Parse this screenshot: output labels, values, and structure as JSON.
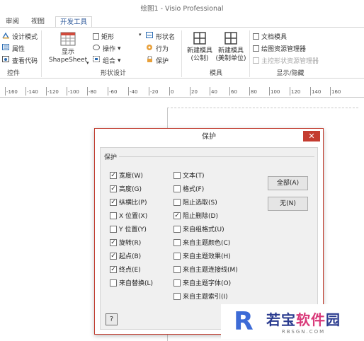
{
  "window": {
    "title": "绘图1 - Visio Professional"
  },
  "tabs": [
    {
      "label": "审阅"
    },
    {
      "label": "视图"
    },
    {
      "label": "开发工具",
      "active": true
    }
  ],
  "ribbon": {
    "controls_group": {
      "label": "控件",
      "items": [
        "设计模式",
        "属性",
        "查看代码"
      ]
    },
    "shape_design_group": {
      "label": "形状设计",
      "show_shapesheet_line1": "显示",
      "show_shapesheet_line2": "ShapeSheet",
      "items_col1": [
        "矩形",
        "操作",
        "组合"
      ],
      "items_col2": [
        "形状名",
        "行为",
        "保护"
      ]
    },
    "stencil_group": {
      "label": "模具",
      "new_stencil_metric_line1": "新建模具",
      "new_stencil_metric_line2": "(公制)",
      "new_stencil_us_line1": "新建模具",
      "new_stencil_us_line2": "(美制单位)"
    },
    "show_hide_group": {
      "label": "显示/隐藏",
      "items": [
        {
          "label": "文档模具",
          "enabled": true
        },
        {
          "label": "绘图资源管理器",
          "enabled": true
        },
        {
          "label": "主控形状资源管理器",
          "enabled": false
        }
      ]
    }
  },
  "ruler": {
    "ticks": [
      "-160",
      "-140",
      "-120",
      "-100",
      "-80",
      "-60",
      "-40",
      "-20",
      "0",
      "20",
      "40",
      "60",
      "80",
      "100",
      "120",
      "140",
      "160"
    ]
  },
  "dialog": {
    "title": "保护",
    "close_glyph": "✕",
    "group_label": "保护",
    "left_column": [
      {
        "label": "宽度(W)",
        "checked": true
      },
      {
        "label": "高度(G)",
        "checked": true
      },
      {
        "label": "纵横比(P)",
        "checked": true
      },
      {
        "label": "X 位置(X)",
        "checked": false
      },
      {
        "label": "Y 位置(Y)",
        "checked": false
      },
      {
        "label": "旋转(R)",
        "checked": true
      },
      {
        "label": "起点(B)",
        "checked": true
      },
      {
        "label": "终点(E)",
        "checked": true
      },
      {
        "label": "来自替换(L)",
        "checked": false
      }
    ],
    "middle_column": [
      {
        "label": "文本(T)",
        "checked": false
      },
      {
        "label": "格式(F)",
        "checked": false
      },
      {
        "label": "阻止选取(S)",
        "checked": false
      },
      {
        "label": "阻止删除(D)",
        "checked": true
      },
      {
        "label": "来自组格式(U)",
        "checked": false
      },
      {
        "label": "来自主题颜色(C)",
        "checked": false
      },
      {
        "label": "来自主题效果(H)",
        "checked": false
      },
      {
        "label": "来自主题连接线(M)",
        "checked": false
      },
      {
        "label": "来自主题字体(O)",
        "checked": false
      },
      {
        "label": "来自主题索引(I)",
        "checked": false
      }
    ],
    "all_button": "全部(A)",
    "none_button": "无(N)",
    "help_glyph": "?"
  },
  "watermark": {
    "logo_letter": "R",
    "text_part1": "若宝",
    "text_part2": "软件",
    "text_part3": "园",
    "url": "RBSGN.COM"
  },
  "colors": {
    "accent_tab": "#2b579a",
    "close_button": "#c43c30",
    "watermark_blue": "#3d6bd6",
    "watermark_pink": "#d93a7a"
  }
}
